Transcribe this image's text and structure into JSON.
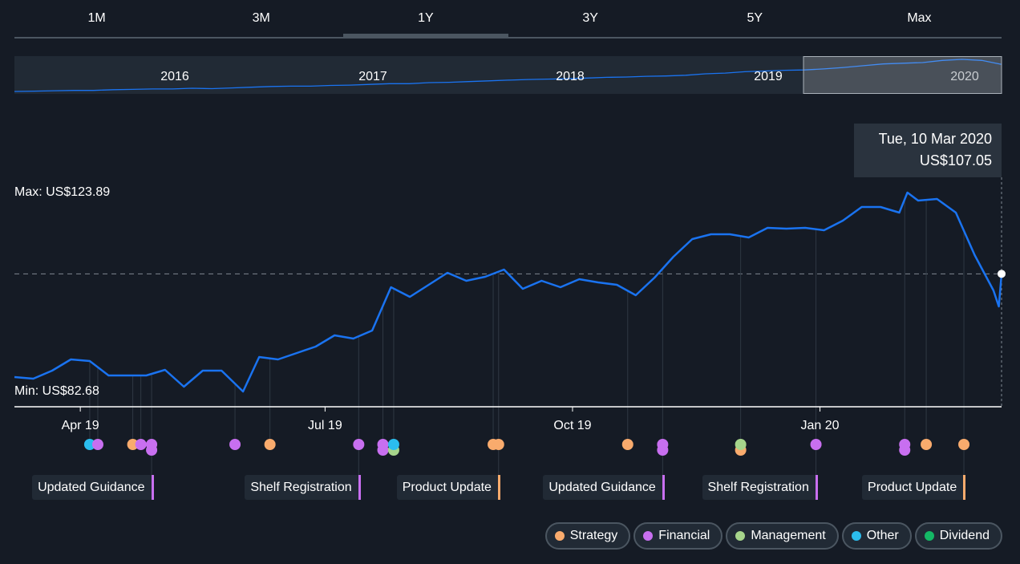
{
  "tabs": [
    {
      "label": "1M",
      "active": false
    },
    {
      "label": "3M",
      "active": false
    },
    {
      "label": "1Y",
      "active": true
    },
    {
      "label": "3Y",
      "active": false
    },
    {
      "label": "5Y",
      "active": false
    },
    {
      "label": "Max",
      "active": false
    }
  ],
  "navigator": {
    "years": [
      "2016",
      "2017",
      "2018",
      "2019",
      "2020"
    ],
    "selected_range": "1Y",
    "values": [
      30,
      31,
      32,
      33,
      33,
      35,
      36,
      37,
      37,
      39,
      38,
      40,
      42,
      44,
      45,
      45,
      47,
      48,
      50,
      52,
      52,
      55,
      56,
      58,
      60,
      62,
      64,
      65,
      66,
      68,
      70,
      71,
      73,
      74,
      76,
      80,
      82,
      86,
      88,
      90,
      91,
      94,
      98,
      103,
      108,
      110,
      112,
      118,
      121,
      118,
      107
    ]
  },
  "colors": {
    "line": "#1a73f0",
    "Strategy": "#f9ab6d",
    "Financial": "#c86ff0",
    "Management": "#a6d58b",
    "Other": "#2bbdee",
    "Dividend": "#14b865"
  },
  "chart_data": {
    "type": "line",
    "currency": "US$",
    "max_label": "Max: US$123.89",
    "min_label": "Min: US$82.68",
    "max": 123.89,
    "min": 82.68,
    "xlim": [
      "2019-03-09",
      "2020-03-10"
    ],
    "x_ticks": [
      {
        "label": "Apr 19",
        "date": "2019-04-01"
      },
      {
        "label": "Jul 19",
        "date": "2019-07-01"
      },
      {
        "label": "Oct 19",
        "date": "2019-10-01"
      },
      {
        "label": "Jan 20",
        "date": "2020-01-01"
      }
    ],
    "series": [
      {
        "points": [
          [
            "2019-03-09",
            85.67
          ],
          [
            "2019-03-16",
            85.34
          ],
          [
            "2019-03-23",
            87.0
          ],
          [
            "2019-03-30",
            89.33
          ],
          [
            "2019-04-06",
            89.0
          ],
          [
            "2019-04-13",
            86.0
          ],
          [
            "2019-04-20",
            86.0
          ],
          [
            "2019-04-27",
            86.0
          ],
          [
            "2019-05-04",
            87.17
          ],
          [
            "2019-05-11",
            83.68
          ],
          [
            "2019-05-18",
            87.0
          ],
          [
            "2019-05-25",
            87.0
          ],
          [
            "2019-06-02",
            82.68
          ],
          [
            "2019-06-08",
            89.83
          ],
          [
            "2019-06-15",
            89.33
          ],
          [
            "2019-06-22",
            90.66
          ],
          [
            "2019-06-29",
            91.99
          ],
          [
            "2019-07-06",
            94.31
          ],
          [
            "2019-07-13",
            93.65
          ],
          [
            "2019-07-20",
            95.31
          ],
          [
            "2019-07-27",
            104.29
          ],
          [
            "2019-08-03",
            102.29
          ],
          [
            "2019-08-10",
            104.78
          ],
          [
            "2019-08-17",
            107.27
          ],
          [
            "2019-08-24",
            105.61
          ],
          [
            "2019-08-31",
            106.44
          ],
          [
            "2019-09-07",
            107.94
          ],
          [
            "2019-09-14",
            103.95
          ],
          [
            "2019-09-21",
            105.61
          ],
          [
            "2019-09-28",
            104.29
          ],
          [
            "2019-10-05",
            105.94
          ],
          [
            "2019-10-12",
            105.28
          ],
          [
            "2019-10-19",
            104.78
          ],
          [
            "2019-10-26",
            102.62
          ],
          [
            "2019-11-02",
            106.28
          ],
          [
            "2019-11-09",
            110.6
          ],
          [
            "2019-11-16",
            114.25
          ],
          [
            "2019-11-23",
            115.25
          ],
          [
            "2019-11-30",
            115.25
          ],
          [
            "2019-12-07",
            114.58
          ],
          [
            "2019-12-14",
            116.58
          ],
          [
            "2019-12-21",
            116.41
          ],
          [
            "2019-12-28",
            116.58
          ],
          [
            "2020-01-04",
            116.08
          ],
          [
            "2020-01-11",
            118.07
          ],
          [
            "2020-01-18",
            120.9
          ],
          [
            "2020-01-25",
            120.9
          ],
          [
            "2020-02-01",
            119.74
          ],
          [
            "2020-02-04",
            123.89
          ],
          [
            "2020-02-08",
            122.23
          ],
          [
            "2020-02-15",
            122.56
          ],
          [
            "2020-02-22",
            119.74
          ],
          [
            "2020-02-29",
            110.93
          ],
          [
            "2020-03-07",
            103.62
          ],
          [
            "2020-03-09",
            100.3
          ],
          [
            "2020-03-10",
            107.05
          ]
        ]
      }
    ],
    "tooltip": {
      "date": "Tue, 10 Mar 2020",
      "value": "US$107.05"
    },
    "events": [
      {
        "date": "2019-04-06",
        "cats": [
          "Other"
        ]
      },
      {
        "date": "2019-04-09",
        "cats": [
          "Financial"
        ]
      },
      {
        "date": "2019-04-22",
        "cats": [
          "Strategy"
        ]
      },
      {
        "date": "2019-04-25",
        "cats": [
          "Financial"
        ]
      },
      {
        "date": "2019-04-29",
        "cats": [
          "Financial",
          "Financial"
        ],
        "label": "Updated Guidance"
      },
      {
        "date": "2019-05-30",
        "cats": [
          "Financial"
        ]
      },
      {
        "date": "2019-06-12",
        "cats": [
          "Strategy"
        ]
      },
      {
        "date": "2019-07-15",
        "cats": [
          "Financial"
        ],
        "label": "Shelf Registration"
      },
      {
        "date": "2019-07-24",
        "cats": [
          "Financial",
          "Financial"
        ]
      },
      {
        "date": "2019-07-28",
        "cats": [
          "Other",
          "Management"
        ]
      },
      {
        "date": "2019-09-03",
        "cats": [
          "Strategy"
        ]
      },
      {
        "date": "2019-09-05",
        "cats": [
          "Strategy"
        ],
        "label": "Product Update"
      },
      {
        "date": "2019-10-23",
        "cats": [
          "Strategy"
        ]
      },
      {
        "date": "2019-11-05",
        "cats": [
          "Financial",
          "Financial"
        ],
        "label": "Updated Guidance"
      },
      {
        "date": "2019-12-04",
        "cats": [
          "Management",
          "Strategy"
        ]
      },
      {
        "date": "2020-01-01",
        "cats": [
          "Financial"
        ],
        "label": "Shelf Registration"
      },
      {
        "date": "2020-02-03",
        "cats": [
          "Financial",
          "Financial"
        ]
      },
      {
        "date": "2020-02-11",
        "cats": [
          "Strategy"
        ]
      },
      {
        "date": "2020-02-25",
        "cats": [
          "Strategy"
        ],
        "label": "Product Update"
      }
    ],
    "legend": [
      "Strategy",
      "Financial",
      "Management",
      "Other",
      "Dividend"
    ]
  }
}
